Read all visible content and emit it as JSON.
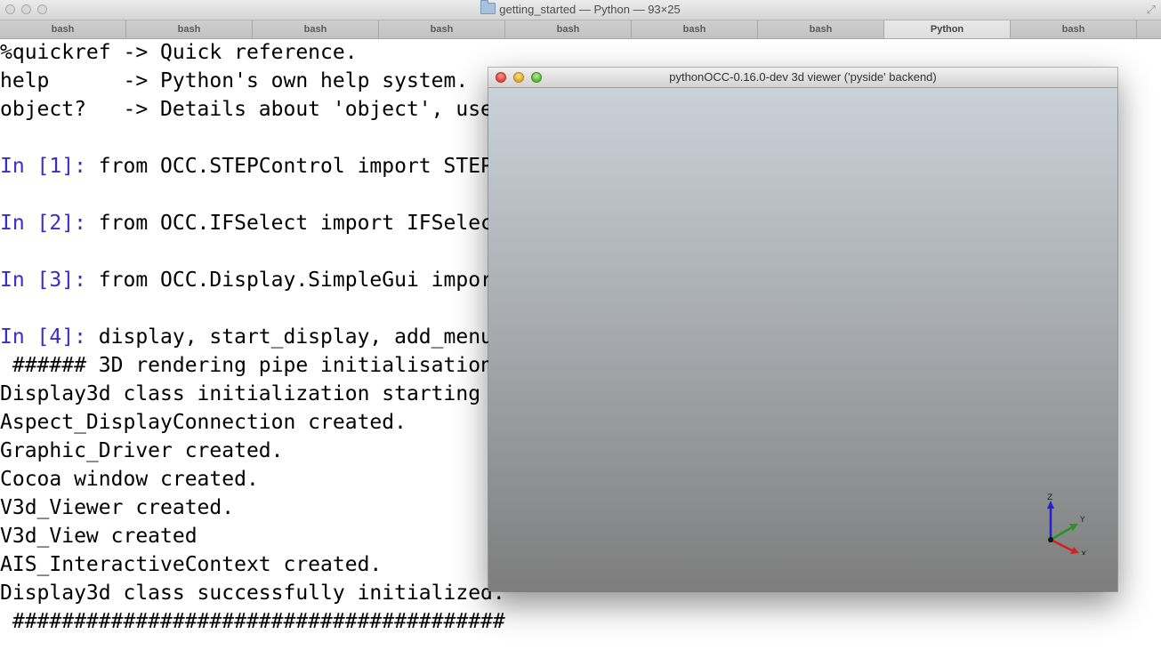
{
  "terminal": {
    "title": "getting_started — Python — 93×25",
    "tabs": [
      {
        "label": "bash",
        "active": false
      },
      {
        "label": "bash",
        "active": false
      },
      {
        "label": "bash",
        "active": false
      },
      {
        "label": "bash",
        "active": false
      },
      {
        "label": "bash",
        "active": false
      },
      {
        "label": "bash",
        "active": false
      },
      {
        "label": "bash",
        "active": false
      },
      {
        "label": "Python",
        "active": true
      },
      {
        "label": "bash",
        "active": false
      }
    ],
    "lines": [
      {
        "prompt": "",
        "text": "%quickref -> Quick reference."
      },
      {
        "prompt": "",
        "text": "help      -> Python's own help system."
      },
      {
        "prompt": "",
        "text": "object?   -> Details about 'object', use"
      },
      {
        "prompt": "",
        "text": ""
      },
      {
        "prompt": "In [1]: ",
        "text": "from OCC.STEPControl import STEP"
      },
      {
        "prompt": "",
        "text": ""
      },
      {
        "prompt": "In [2]: ",
        "text": "from OCC.IFSelect import IFSelec"
      },
      {
        "prompt": "",
        "text": ""
      },
      {
        "prompt": "In [3]: ",
        "text": "from OCC.Display.SimpleGui impor"
      },
      {
        "prompt": "",
        "text": ""
      },
      {
        "prompt": "In [4]: ",
        "text": "display, start_display, add_menu"
      },
      {
        "prompt": "",
        "text": " ###### 3D rendering pipe initialisation"
      },
      {
        "prompt": "",
        "text": "Display3d class initialization starting"
      },
      {
        "prompt": "",
        "text": "Aspect_DisplayConnection created."
      },
      {
        "prompt": "",
        "text": "Graphic_Driver created."
      },
      {
        "prompt": "",
        "text": "Cocoa window created."
      },
      {
        "prompt": "",
        "text": "V3d_Viewer created."
      },
      {
        "prompt": "",
        "text": "V3d_View created"
      },
      {
        "prompt": "",
        "text": "AIS_InteractiveContext created."
      },
      {
        "prompt": "",
        "text": "Display3d class successfully initialized."
      },
      {
        "prompt": "",
        "text": " ########################################"
      }
    ]
  },
  "viewer": {
    "title": "pythonOCC-0.16.0-dev 3d viewer ('pyside' backend)",
    "axes": {
      "x_label": "X",
      "y_label": "Y",
      "z_label": "Z"
    }
  },
  "colors": {
    "prompt": "#3b2bc7",
    "axis_x": "#d42020",
    "axis_y": "#1f9a1f",
    "axis_z": "#1f1fd4"
  }
}
